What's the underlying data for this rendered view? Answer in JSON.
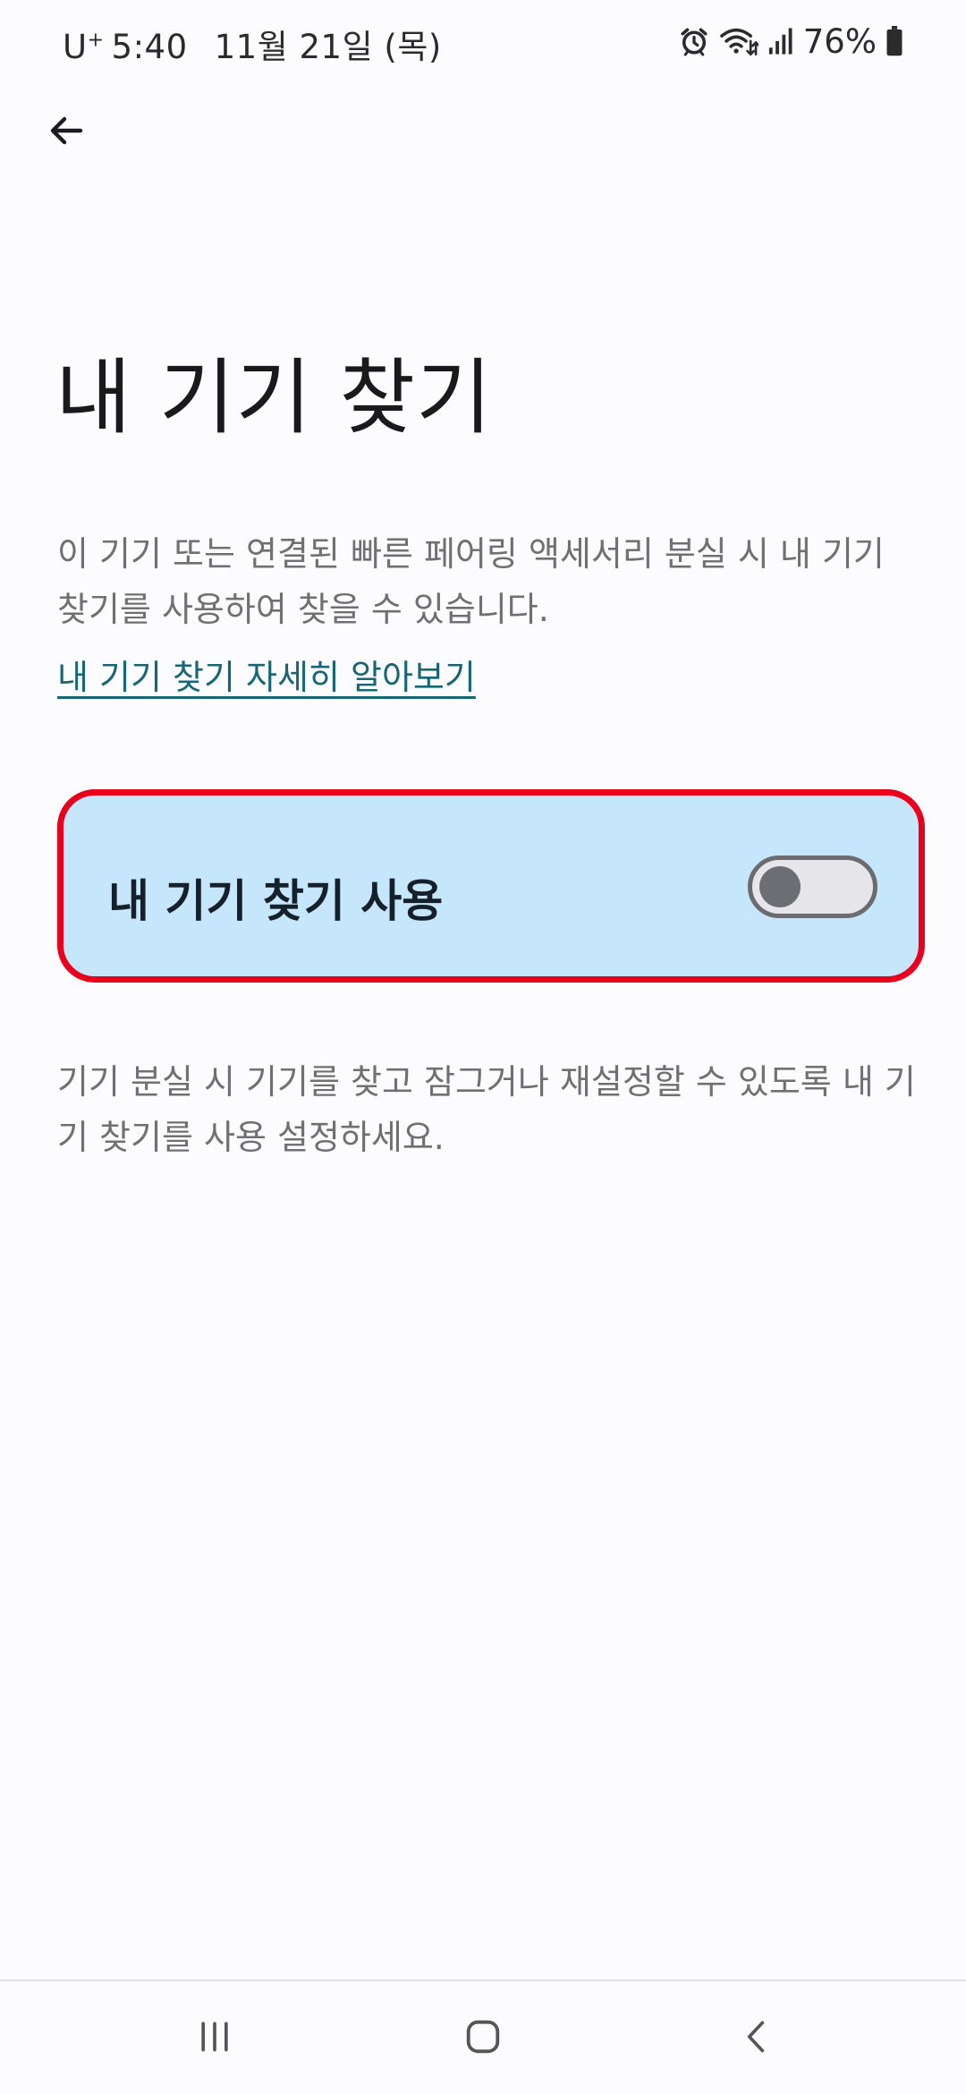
{
  "status_bar": {
    "carrier": "U",
    "carrier_plus": "+",
    "time": "5:40",
    "date": "11월 21일 (목)",
    "battery": "76%",
    "icons": [
      "alarm-icon",
      "wifi-icon",
      "signal-icon",
      "battery-icon"
    ]
  },
  "header": {
    "back_icon": "arrow-left-icon"
  },
  "page": {
    "title": "내 기기 찾기",
    "description": "이 기기 또는 연결된 빠른 페어링 액세서리 분실 시 내 기기 찾기를 사용하여 찾을 수 있습니다.",
    "learn_more": "내 기기 찾기 자세히 알아보기"
  },
  "toggle": {
    "label": "내 기기 찾기 사용",
    "state": "off"
  },
  "helper": {
    "text": "기기 분실 시 기기를 찾고 잠그거나 재설정할 수 있도록 내 기기 찾기를 사용 설정하세요."
  },
  "nav_bar": {
    "icons": [
      "recents-icon",
      "home-icon",
      "back-icon"
    ]
  },
  "colors": {
    "background": "#fcfbfd",
    "card_background": "#c6e6fb",
    "highlight_border": "#e8001c",
    "link": "#176675",
    "secondary_text": "#707070"
  }
}
